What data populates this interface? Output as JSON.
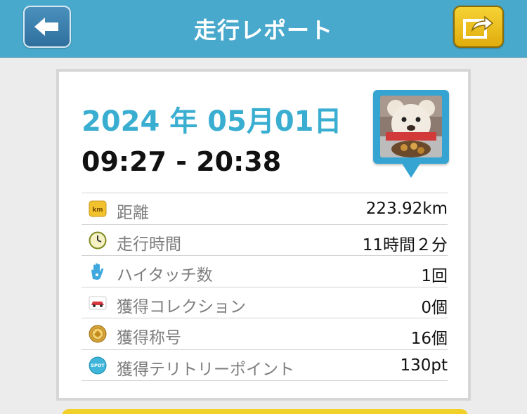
{
  "header": {
    "title": "走行レポート",
    "back_icon": "arrow-left-icon",
    "share_icon": "share-icon",
    "colors": {
      "bar": "#49a9cc",
      "back": "#3a80af",
      "share": "#eec21f"
    }
  },
  "report": {
    "date": "2024 年 05月01日",
    "time_range": "09:27 - 20:38",
    "photo": "teddy-bear-photo",
    "accent_color": "#3aaed1"
  },
  "stats": [
    {
      "icon": "km-icon",
      "label": "距離",
      "value": "223.92km"
    },
    {
      "icon": "clock-icon",
      "label": "走行時間",
      "value": "11時間２分"
    },
    {
      "icon": "hand-icon",
      "label": "ハイタッチ数",
      "value": "1回"
    },
    {
      "icon": "car-icon",
      "label": "獲得コレクション",
      "value": "0個"
    },
    {
      "icon": "medal-icon",
      "label": "獲得称号",
      "value": "16個"
    },
    {
      "icon": "spot-icon",
      "label": "獲得テリトリーポイント",
      "value": "130pt"
    }
  ],
  "icon_texts": {
    "km": "km",
    "spot": "SPOT"
  }
}
